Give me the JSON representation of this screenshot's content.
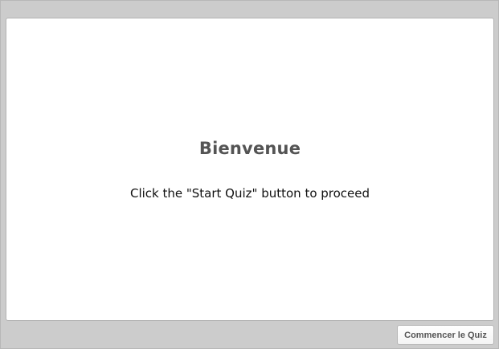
{
  "slide": {
    "title": "Bienvenue",
    "instruction": "Click the \"Start Quiz\" button to proceed"
  },
  "footer": {
    "start_button_label": "Commencer le Quiz"
  }
}
